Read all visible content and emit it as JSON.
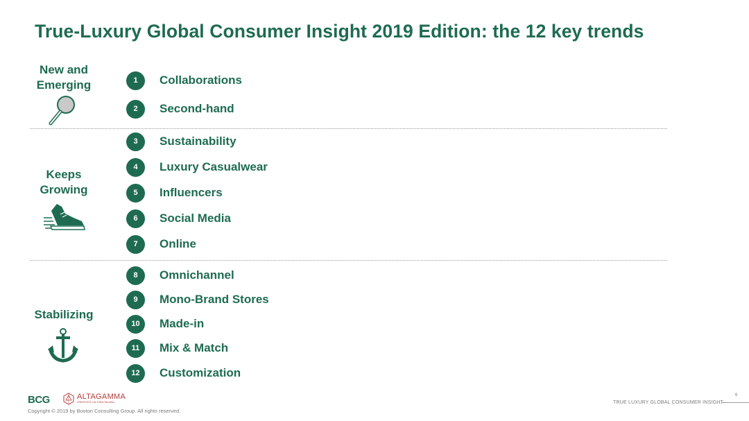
{
  "title": "True-Luxury Global Consumer Insight 2019 Edition: the 12 key trends",
  "categories": [
    {
      "label": "New and Emerging",
      "icon": "magnifying-glass-icon"
    },
    {
      "label": "Keeps Growing",
      "icon": "running-sneaker-icon"
    },
    {
      "label": "Stabilizing",
      "icon": "anchor-icon"
    }
  ],
  "trends": [
    {
      "number": "1",
      "label": "Collaborations"
    },
    {
      "number": "2",
      "label": "Second-hand"
    },
    {
      "number": "3",
      "label": "Sustainability"
    },
    {
      "number": "4",
      "label": "Luxury Casualwear"
    },
    {
      "number": "5",
      "label": "Influencers"
    },
    {
      "number": "6",
      "label": "Social Media"
    },
    {
      "number": "7",
      "label": "Online"
    },
    {
      "number": "8",
      "label": "Omnichannel"
    },
    {
      "number": "9",
      "label": "Mono-Brand Stores"
    },
    {
      "number": "10",
      "label": "Made-in"
    },
    {
      "number": "11",
      "label": "Mix & Match"
    },
    {
      "number": "12",
      "label": "Customization"
    }
  ],
  "footer": {
    "bcg_logo": "BCG",
    "altagamma_logo": "ALTAGAMMA",
    "altagamma_tagline": "CREATIVITÀ CULTURA ITALIANA",
    "copyright": "Copyright © 2019 by Boston Consulting Group. All rights reserved.",
    "page_number": "6",
    "report_name": "TRUE LUXURY GLOBAL CONSUMER INSIGHT"
  },
  "colors": {
    "primary_green": "#1e6b52",
    "altagamma_red": "#b63a3a",
    "divider_gray": "#9a9a9a"
  }
}
